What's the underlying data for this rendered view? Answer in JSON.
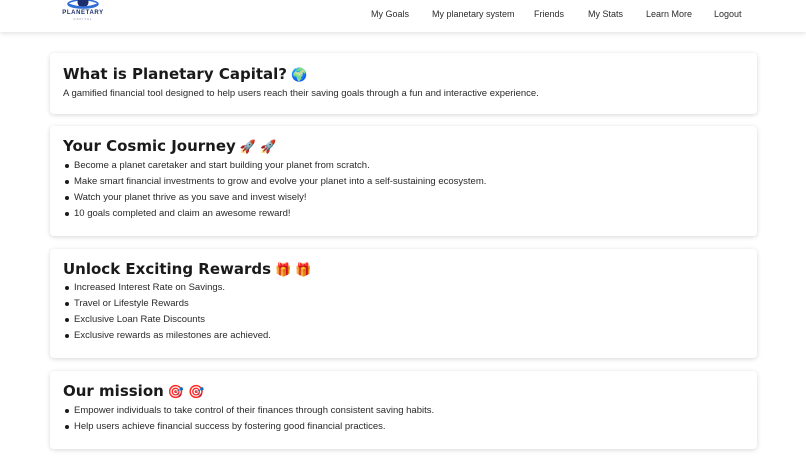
{
  "brand": {
    "name": "PLANETARY",
    "sub": "CAPITAL"
  },
  "nav": {
    "items": [
      {
        "label": "My Goals"
      },
      {
        "label": "My planetary system"
      },
      {
        "label": "Friends"
      },
      {
        "label": "My Stats"
      },
      {
        "label": "Learn More"
      },
      {
        "label": "Logout"
      }
    ]
  },
  "sections": [
    {
      "title": "What is Planetary Capital?",
      "emoji": "🌍",
      "text": "A gamified financial tool designed to help users reach their saving goals through a fun and interactive experience."
    },
    {
      "title": "Your Cosmic Journey",
      "emoji": "🚀 🚀",
      "items": [
        "Become a planet caretaker and start building your planet from scratch.",
        "Make smart financial investments to grow and evolve your planet into a self-sustaining ecosystem.",
        "Watch your planet thrive as you save and invest wisely!",
        "10 goals completed and claim an awesome reward!"
      ]
    },
    {
      "title": "Unlock Exciting Rewards",
      "emoji": "🎁 🎁",
      "items": [
        "Increased Interest Rate on Savings.",
        "Travel or Lifestyle Rewards",
        "Exclusive Loan Rate Discounts",
        "Exclusive rewards as milestones are achieved."
      ]
    },
    {
      "title": "Our mission",
      "emoji": "🎯 🎯",
      "items": [
        "Empower individuals to take control of their finances through consistent saving habits.",
        "Help users achieve financial success by fostering good financial practices."
      ]
    }
  ],
  "colors": {
    "brand_navy": "#1c2e6b",
    "brand_blue": "#2f6fd6",
    "text": "#2a2a2a"
  }
}
